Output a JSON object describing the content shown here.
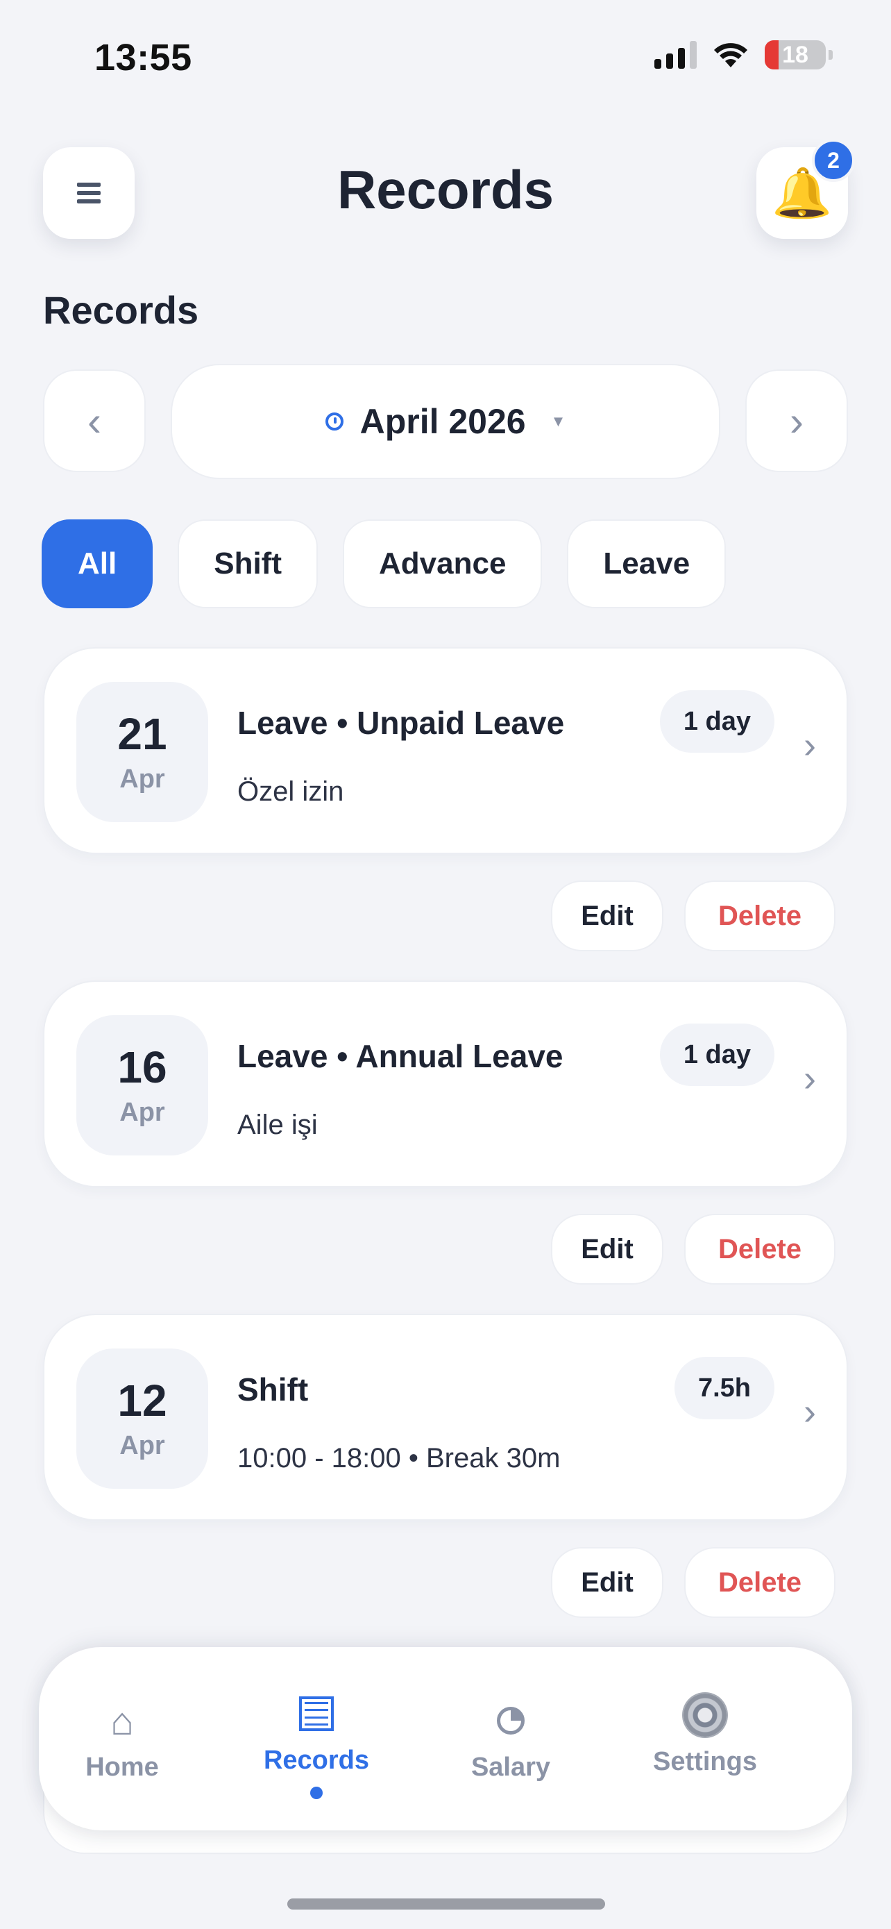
{
  "status": {
    "time": "13:55",
    "battery": "18"
  },
  "header": {
    "title": "Records",
    "notification_count": "2"
  },
  "section_title": "Records",
  "month_picker": {
    "label": "April 2026",
    "prev": "‹",
    "next": "›"
  },
  "filters": [
    "All",
    "Shift",
    "Advance",
    "Leave"
  ],
  "records": [
    {
      "day": "21",
      "month": "Apr",
      "title": "Leave • Unpaid Leave",
      "subtitle": "Özel izin",
      "pill": "1 day"
    },
    {
      "day": "16",
      "month": "Apr",
      "title": "Leave • Annual Leave",
      "subtitle": "Aile işi",
      "pill": "1 day"
    },
    {
      "day": "12",
      "month": "Apr",
      "title": "Shift",
      "subtitle": "10:00 - 18:00 • Break 30m",
      "pill": "7.5h"
    }
  ],
  "actions": {
    "edit": "Edit",
    "delete": "Delete"
  },
  "bottom_nav": [
    {
      "label": "Home",
      "icon": "home-icon"
    },
    {
      "label": "Records",
      "icon": "records-icon"
    },
    {
      "label": "Salary",
      "icon": "pie-chart-icon"
    },
    {
      "label": "Settings",
      "icon": "gear-icon"
    }
  ],
  "colors": {
    "accent": "#2f6fe6",
    "danger": "#e05555",
    "background": "#f3f4f8"
  }
}
